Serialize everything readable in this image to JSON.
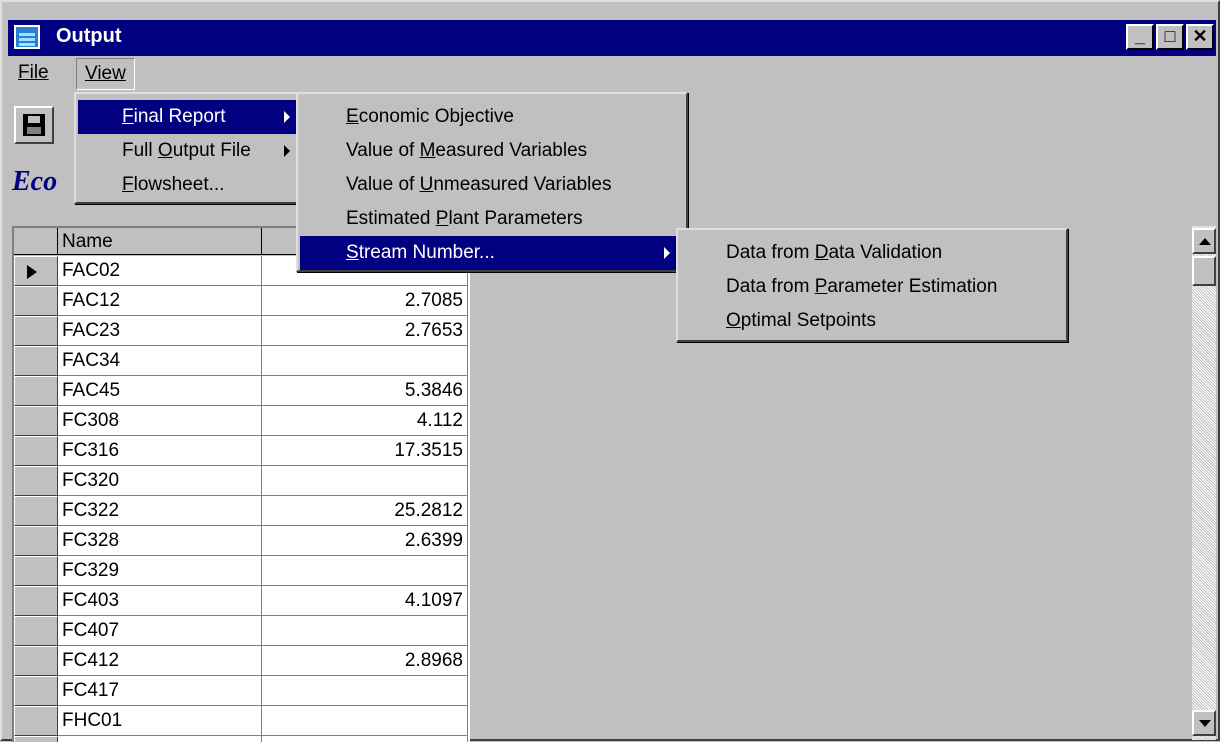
{
  "window": {
    "title": "Output",
    "min_glyph": "_",
    "max_glyph": "□",
    "close_glyph": "✕"
  },
  "menubar": {
    "file": "File",
    "view": "View"
  },
  "toolbar": {
    "save_icon": "floppy-disk-icon"
  },
  "heading": "Eco",
  "grid": {
    "header": {
      "name": "Name",
      "value": ""
    },
    "rows": [
      {
        "name": "FAC02",
        "value": ""
      },
      {
        "name": "FAC12",
        "value": "2.7085"
      },
      {
        "name": "FAC23",
        "value": "2.7653"
      },
      {
        "name": "FAC34",
        "value": ""
      },
      {
        "name": "FAC45",
        "value": "5.3846"
      },
      {
        "name": "FC308",
        "value": "4.112"
      },
      {
        "name": "FC316",
        "value": "17.3515"
      },
      {
        "name": "FC320",
        "value": ""
      },
      {
        "name": "FC322",
        "value": "25.2812"
      },
      {
        "name": "FC328",
        "value": "2.6399"
      },
      {
        "name": "FC329",
        "value": ""
      },
      {
        "name": "FC403",
        "value": "4.1097"
      },
      {
        "name": "FC407",
        "value": ""
      },
      {
        "name": "FC412",
        "value": "2.8968"
      },
      {
        "name": "FC417",
        "value": ""
      },
      {
        "name": "FHC01",
        "value": ""
      },
      {
        "name": "",
        "value": ""
      }
    ]
  },
  "view_menu": [
    {
      "pre": "",
      "u": "F",
      "post": "inal Report",
      "selected": true,
      "submenu": true
    },
    {
      "pre": "Full ",
      "u": "O",
      "post": "utput File",
      "selected": false,
      "submenu": true
    },
    {
      "pre": "",
      "u": "F",
      "post": "lowsheet...",
      "selected": false,
      "submenu": false
    }
  ],
  "final_report_menu": [
    {
      "pre": "",
      "u": "E",
      "post": "conomic Objective",
      "selected": false,
      "submenu": false
    },
    {
      "pre": "Value of ",
      "u": "M",
      "post": "easured Variables",
      "selected": false,
      "submenu": false
    },
    {
      "pre": "Value of ",
      "u": "U",
      "post": "nmeasured Variables",
      "selected": false,
      "submenu": false
    },
    {
      "pre": "Estimated ",
      "u": "P",
      "post": "lant Parameters",
      "selected": false,
      "submenu": false
    },
    {
      "pre": "",
      "u": "S",
      "post": "tream Number...",
      "selected": true,
      "submenu": true
    }
  ],
  "stream_menu": [
    {
      "pre": "Data from ",
      "u": "D",
      "post": "ata Validation",
      "selected": false,
      "submenu": false
    },
    {
      "pre": "Data from ",
      "u": "P",
      "post": "arameter Estimation",
      "selected": false,
      "submenu": false
    },
    {
      "pre": "",
      "u": "O",
      "post": "ptimal Setpoints",
      "selected": false,
      "submenu": false
    }
  ],
  "colors": {
    "title_bar": "#000080",
    "selection": "#000080",
    "face": "#c0c0c0",
    "heading": "#000080"
  }
}
